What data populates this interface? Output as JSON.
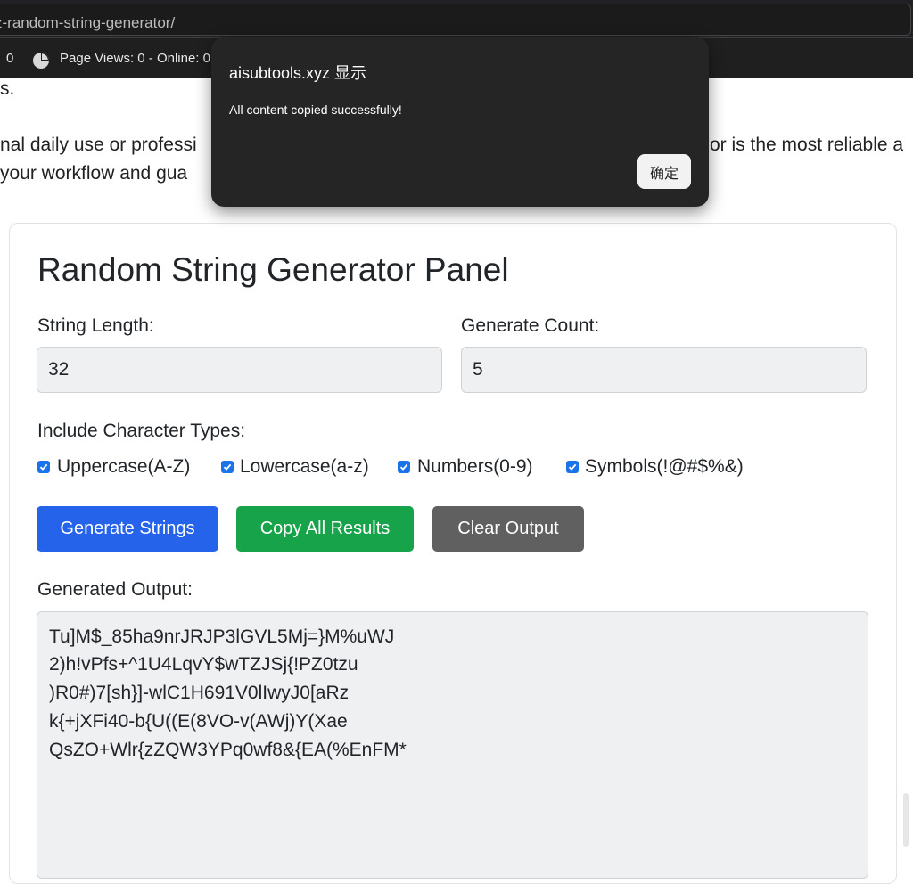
{
  "browser": {
    "url": "xyz-random-string-generator/",
    "stats_count": "0",
    "stats_text": "Page Views: 0 - Online: 0",
    "stats_icon": "pie-chart-icon"
  },
  "page": {
    "fragment_1": "s.",
    "fragment_2a": "nal daily use or professi",
    "fragment_2b": "or is the most reliable a",
    "fragment_3": " your workflow and gua"
  },
  "panel": {
    "title": "Random String Generator Panel",
    "length_label": "String Length:",
    "length_value": "32",
    "count_label": "Generate Count:",
    "count_value": "5",
    "types_label": "Include Character Types:",
    "checkboxes": [
      {
        "label": "Uppercase(A-Z)",
        "checked": true
      },
      {
        "label": "Lowercase(a-z)",
        "checked": true
      },
      {
        "label": "Numbers(0-9)",
        "checked": true
      },
      {
        "label": "Symbols(!@#$%&)",
        "checked": true
      }
    ],
    "buttons": {
      "generate": "Generate Strings",
      "copy": "Copy All Results",
      "clear": "Clear Output"
    },
    "output_label": "Generated Output:",
    "output_lines": [
      "Tu]M$_85ha9nrJRJP3lGVL5Mj=}M%uWJ",
      "2)h!vPfs+^1U4LqvY$wTZJSj{!PZ0tzu",
      ")R0#)7[sh}]-wlC1H691V0lIwyJ0[aRz",
      "k{+jXFi40-b{U((E(8VO-v(AWj)Y(Xae",
      "QsZO+Wlr{zZQW3YPq0wf8&{EA(%EnFM*"
    ]
  },
  "dialog": {
    "title": "aisubtools.xyz 显示",
    "message": "All content copied successfully!",
    "ok_label": "确定"
  },
  "colors": {
    "generate_btn": "#2563eb",
    "copy_btn": "#16a34a",
    "clear_btn": "#606060",
    "checkbox": "#1a73e8",
    "dialog_bg": "#252525"
  }
}
